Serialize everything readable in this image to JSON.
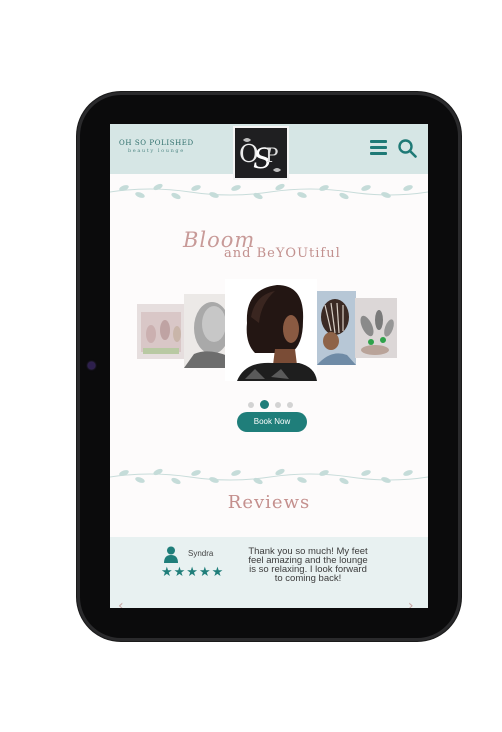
{
  "brand": {
    "name": "OH SO POLISHED",
    "subtitle": "beauty lounge",
    "logo_letters": "OSP"
  },
  "header": {
    "menu_icon": "hamburger-menu-icon",
    "search_icon": "search-icon"
  },
  "hero": {
    "script_word": "Bloom",
    "tagline": "and BeYOUtiful"
  },
  "carousel": {
    "slide_count": 4,
    "active_index": 1
  },
  "cta": {
    "book_label": "Book Now"
  },
  "reviews": {
    "title": "Reviews",
    "items": [
      {
        "name": "Syndra",
        "rating": 5,
        "stars": "★★★★★",
        "text": "Thank you so much! My feet feel amazing and the lounge is so relaxing. I look forward to coming back!"
      }
    ],
    "prev_arrow": "‹",
    "next_arrow": "›"
  },
  "colors": {
    "teal": "#1f7e7a",
    "header_bg": "#d6e6e5",
    "rose": "#c48f8d",
    "review_bg": "#e8f1f1"
  }
}
